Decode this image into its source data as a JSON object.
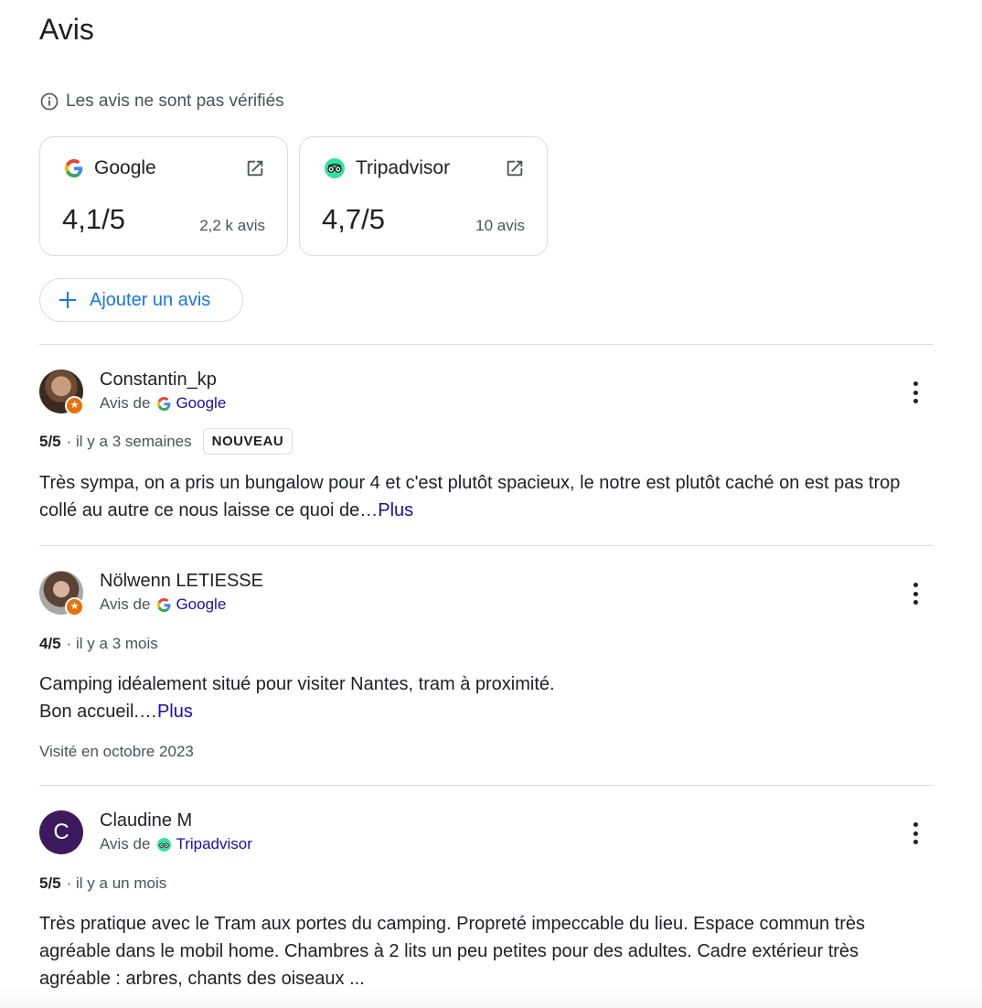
{
  "header": {
    "title": "Avis"
  },
  "notice": {
    "text": "Les avis ne sont pas vérifiés"
  },
  "sources": [
    {
      "name": "Google",
      "score": "4,1/5",
      "count": "2,2 k avis"
    },
    {
      "name": "Tripadvisor",
      "score": "4,7/5",
      "count": "10 avis"
    }
  ],
  "add_review": {
    "label": "Ajouter un avis"
  },
  "reviews": [
    {
      "author": "Constantin_kp",
      "source_prefix": "Avis de",
      "source": "Google",
      "rating": "5/5",
      "time": "· il y a 3 semaines",
      "tag": "NOUVEAU",
      "text": "Très sympa, on a pris un bungalow pour 4 et c'est plutôt spacieux, le notre est plutôt caché on est pas trop collé au autre ce nous laisse ce quoi de…",
      "more": "Plus"
    },
    {
      "author": "Nölwenn LETIESSE",
      "source_prefix": "Avis de",
      "source": "Google",
      "rating": "4/5",
      "time": "· il y a 3 mois",
      "text_line1": "Camping idéalement situé pour visiter Nantes, tram à proximité.",
      "text_line2": "Bon accueil.…",
      "more": "Plus",
      "visited": "Visité en octobre 2023"
    },
    {
      "author": "Claudine M",
      "avatar_letter": "C",
      "source_prefix": "Avis de",
      "source": "Tripadvisor",
      "rating": "5/5",
      "time": "· il y a un mois",
      "text": "Très pratique avec le Tram aux portes du camping. Propreté impeccable du lieu. Espace commun très agréable dans le mobil home. Chambres à 2 lits un peu petites pour des adultes. Cadre extérieur très agréable : arbres, chants des oiseaux ..."
    }
  ],
  "colors": {
    "link": "#1a0dab",
    "accent": "#1a73e8",
    "badge": "#e8710a",
    "tripadvisor": "#34e0a1",
    "avatar_letter_bg": "#3d1a5e"
  }
}
